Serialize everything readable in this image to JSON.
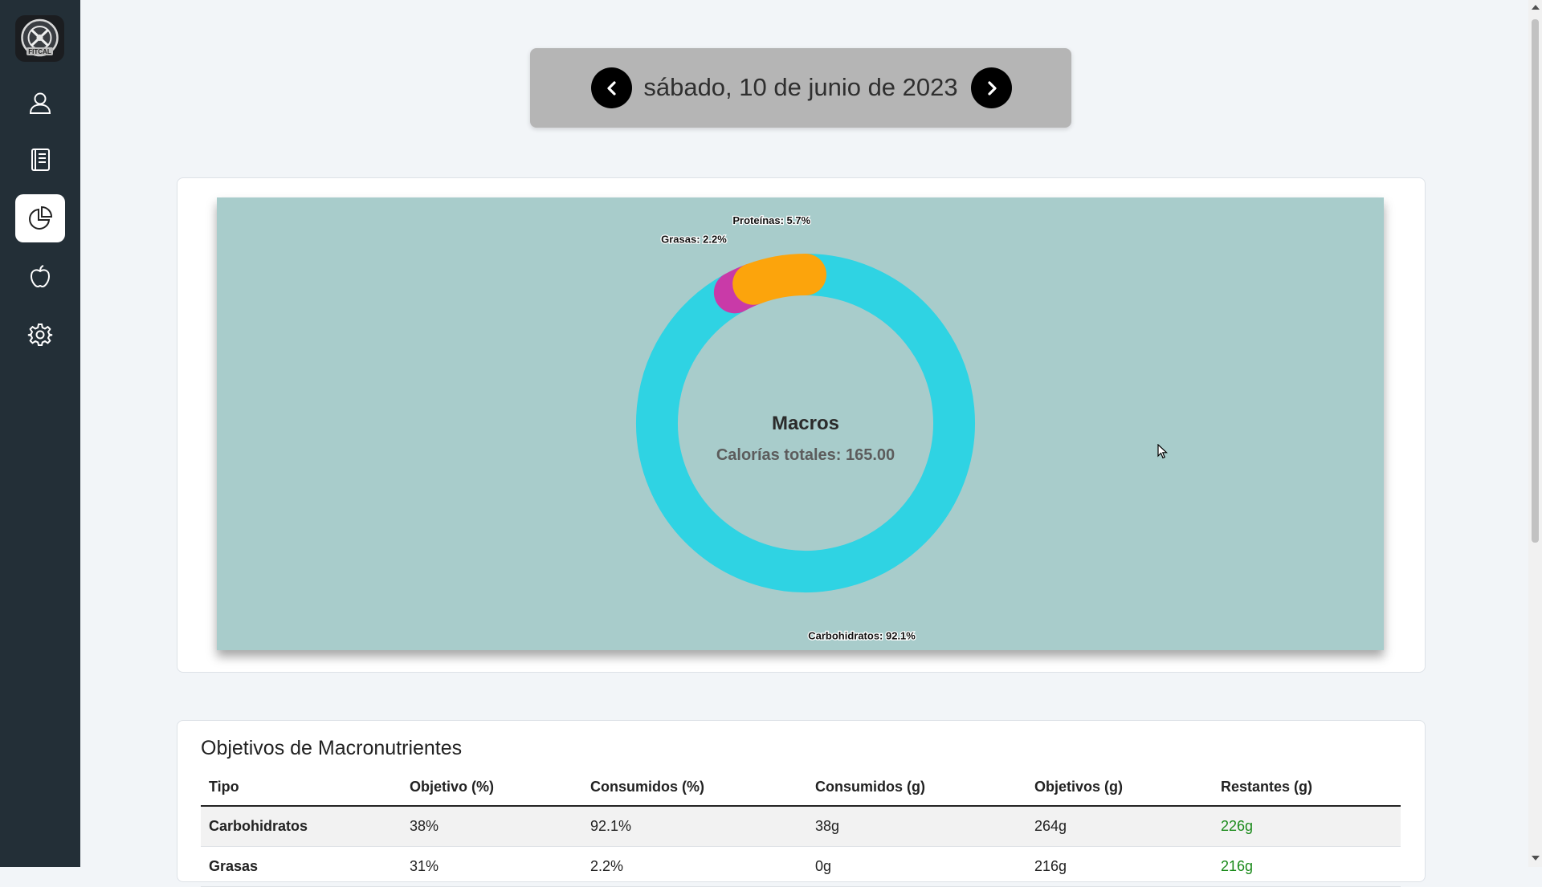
{
  "nav": {
    "logo_text": "FITCAL",
    "items": [
      {
        "name": "profile",
        "icon": "user-icon"
      },
      {
        "name": "diary",
        "icon": "book-icon"
      },
      {
        "name": "stats",
        "icon": "pie-chart-icon",
        "active": true
      },
      {
        "name": "foods",
        "icon": "apple-icon"
      },
      {
        "name": "settings",
        "icon": "gear-icon"
      }
    ]
  },
  "date_nav": {
    "date_label": "sábado, 10 de junio de 2023",
    "prev_icon": "chevron-left-icon",
    "next_icon": "chevron-right-icon"
  },
  "chart_data": {
    "type": "pie",
    "variant": "doughnut",
    "title": "Macros",
    "subtitle": "Calorías totales: 165.00",
    "slices": [
      {
        "label": "Carbohidratos: 92.1%",
        "name": "Carbohidratos",
        "value": 92.1,
        "color": "#2fd3e3"
      },
      {
        "label": "Grasas: 2.2%",
        "name": "Grasas",
        "value": 2.2,
        "color": "#c93aa8"
      },
      {
        "label": "Proteínas: 5.7%",
        "name": "Proteínas",
        "value": 5.7,
        "color": "#fca40c"
      }
    ],
    "background": "#a8cccb"
  },
  "table": {
    "title": "Objetivos de Macronutrientes",
    "headers": [
      "Tipo",
      "Objetivo (%)",
      "Consumidos (%)",
      "Consumidos (g)",
      "Objetivos (g)",
      "Restantes (g)"
    ],
    "rows": [
      {
        "tipo": "Carbohidratos",
        "objetivo_pct": "38%",
        "consumidos_pct": "92.1%",
        "consumidos_g": "38g",
        "objetivos_g": "264g",
        "restantes_g": "226g"
      },
      {
        "tipo": "Grasas",
        "objetivo_pct": "31%",
        "consumidos_pct": "2.2%",
        "consumidos_g": "0g",
        "objetivos_g": "216g",
        "restantes_g": "216g"
      }
    ]
  },
  "colors": {
    "sidebar": "#232f37",
    "page_background": "#f2f5f8",
    "date_bar": "#b5b5b5",
    "remaining_text": "#1a8a1a"
  }
}
